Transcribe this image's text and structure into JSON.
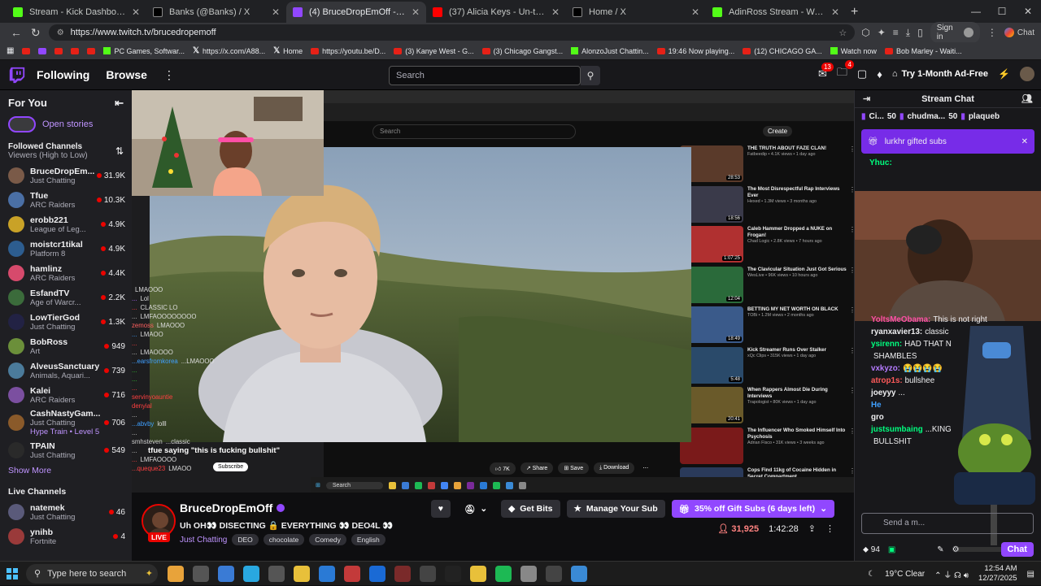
{
  "browser": {
    "tabs": [
      {
        "title": "Stream - Kick Dashboard",
        "color": "#53fc18",
        "active": false
      },
      {
        "title": "Banks (@Banks) / X",
        "color": "#000000",
        "active": false
      },
      {
        "title": "(4) BruceDropEmOff - Twitch",
        "color": "#9147ff",
        "active": true
      },
      {
        "title": "(37) Alicia Keys - Un-thinkable (I'm",
        "color": "#ff0000",
        "active": false
      },
      {
        "title": "Home / X",
        "color": "#000000",
        "active": false
      },
      {
        "title": "AdinRoss Stream - Watch Live on",
        "color": "#53fc18",
        "active": false
      }
    ],
    "url": "https://www.twitch.tv/brucedropemoff",
    "signin_label": "Sign in",
    "chat_label": "Chat",
    "bookmarks": [
      {
        "label": "",
        "type": "yt"
      },
      {
        "label": "",
        "type": "tw"
      },
      {
        "label": "",
        "type": "yt"
      },
      {
        "label": "",
        "type": "yt"
      },
      {
        "label": "",
        "type": "yt"
      },
      {
        "label": "PC Games, Softwar...",
        "type": "k"
      },
      {
        "label": "https://x.com/A88...",
        "type": "x"
      },
      {
        "label": "Home",
        "type": "x"
      },
      {
        "label": "https://youtu.be/D...",
        "type": "yt"
      },
      {
        "label": "(3) Kanye West - G...",
        "type": "yt"
      },
      {
        "label": "(3) Chicago Gangst...",
        "type": "yt"
      },
      {
        "label": "AlonzoJust Chattin...",
        "type": "k"
      },
      {
        "label": "19:46 Now playing...",
        "type": "yt"
      },
      {
        "label": "(12) CHICAGO GA...",
        "type": "yt"
      },
      {
        "label": "Watch now",
        "type": "k"
      },
      {
        "label": "Bob Marley - Waiti...",
        "type": "yt"
      }
    ]
  },
  "twitch": {
    "nav": {
      "following": "Following",
      "browse": "Browse",
      "search_placeholder": "Search",
      "notif_count": "13",
      "inbox_count": "4",
      "adfree": "Try 1-Month Ad-Free"
    },
    "sidebar": {
      "for_you": "For You",
      "open_stories": "Open stories",
      "followed_title": "Followed Channels",
      "followed_sort": "Viewers (High to Low)",
      "channels": [
        {
          "name": "BruceDropEm...",
          "game": "Just Chatting",
          "viewers": "31.9K",
          "color": "#7a5a48"
        },
        {
          "name": "Tfue",
          "game": "ARC Raiders",
          "viewers": "10.3K",
          "color": "#4a6fa5"
        },
        {
          "name": "erobb221",
          "game": "League of Leg...",
          "viewers": "4.9K",
          "color": "#c9a227"
        },
        {
          "name": "moistcr1tikal",
          "game": "Platform 8",
          "viewers": "4.9K",
          "color": "#2d5d8f"
        },
        {
          "name": "hamlinz",
          "game": "ARC Raiders",
          "viewers": "4.4K",
          "color": "#d64a6c"
        },
        {
          "name": "EsfandTV",
          "game": "Age of Warcr...",
          "viewers": "2.2K",
          "color": "#3b6b3b"
        },
        {
          "name": "LowTierGod",
          "game": "Just Chatting",
          "viewers": "1.3K",
          "color": "#222244"
        },
        {
          "name": "BobRoss",
          "game": "Art",
          "viewers": "949",
          "color": "#6b8f3a"
        },
        {
          "name": "AlveusSanctuary",
          "game": "Animals, Aquari...",
          "viewers": "739",
          "color": "#4b7b9b"
        },
        {
          "name": "Kalei",
          "game": "ARC Raiders",
          "viewers": "716",
          "color": "#7b4fa0"
        },
        {
          "name": "CashNastyGam...",
          "game": "Just Chatting",
          "viewers": "706",
          "color": "#8a5a2a",
          "extra": "Hype Train • Level 5"
        },
        {
          "name": "TPAIN",
          "game": "Just Chatting",
          "viewers": "549",
          "color": "#2a2a2a"
        }
      ],
      "show_more": "Show More",
      "live_title": "Live Channels",
      "live": [
        {
          "name": "natemek",
          "game": "Just Chatting",
          "viewers": "46",
          "color": "#5a5a7a"
        },
        {
          "name": "ynihb",
          "game": "Fortnite",
          "viewers": "4",
          "color": "#9a3a3a"
        }
      ]
    },
    "video": {
      "yt_search": "Search",
      "yt_create": "Create",
      "caption": "tfue saying \"this is fucking bullshit\"",
      "actions": [
        "7K",
        "Share",
        "Save",
        "Download"
      ],
      "subscribe": "Subscribe",
      "recs": [
        {
          "title": "THE TRUTH ABOUT FAZE CLAN!",
          "meta": "Fatbeedip • 4.1K views • 1 day ago",
          "dur": "28:53",
          "color": "#5a3a2a"
        },
        {
          "title": "The Most Disrespectful Rap Interviews Ever",
          "meta": "Hexed • 1.3M views • 3 months ago",
          "dur": "18:56",
          "color": "#3a3a4a"
        },
        {
          "title": "Caleb Hammer Dropped a NUKE on Frogan!",
          "meta": "Chad Logic • 2.8K views • 7 hours ago",
          "dur": "1:07:25",
          "color": "#b03030"
        },
        {
          "title": "The Clavicular Situation Just Got Serious",
          "meta": "WesLive • 96K views • 10 hours ago",
          "dur": "12:04",
          "color": "#2a6a3a"
        },
        {
          "title": "BETTING MY NET WORTH ON BLACK",
          "meta": "TOBi • 1.2M views • 2 months ago",
          "dur": "18:49",
          "color": "#3a5a8a"
        },
        {
          "title": "Kick Streamer Runs Over Stalker",
          "meta": "xQc Clips • 315K views • 1 day ago",
          "dur": "5:48",
          "color": "#2a4a6a"
        },
        {
          "title": "When Rappers Almost Die During Interviews",
          "meta": "Trapologist • 80K views • 1 day ago",
          "dur": "20:41",
          "color": "#6a5a2a"
        },
        {
          "title": "The Influencer Who Smoked Himself Into Psychosis",
          "meta": "Adrian Fisco • 31K views • 3 weeks ago",
          "dur": "",
          "color": "#7a1a1a"
        },
        {
          "title": "Cops Find 11kg of Cocaine Hidden in Secret Compartment",
          "meta": "",
          "dur": "",
          "color": "#2a3a5a"
        }
      ],
      "overlay_chat": [
        {
          "user": "",
          "text": "LMAOOO",
          "color": "#ff4040"
        },
        {
          "user": "...",
          "text": "Lol",
          "color": "#aa66ff"
        },
        {
          "user": "...",
          "text": "CLASSIC LO",
          "color": "#ff4040"
        },
        {
          "user": "...",
          "text": "LMFAOOOOOOOO",
          "color": "#cccccc"
        },
        {
          "user": "zemoss",
          "text": "LMAOOO",
          "color": "#ff6060"
        },
        {
          "user": "...",
          "text": "LMAOO",
          "color": "#3fa0ff"
        },
        {
          "user": "...",
          "text": "",
          "color": "#ff4040"
        },
        {
          "user": "...",
          "text": "LMAOOOO",
          "color": "#cccccc"
        },
        {
          "user": "...earsfromkorea",
          "text": "...LMAOOO",
          "color": "#3fa0ff"
        },
        {
          "user": "...",
          "text": "",
          "color": "#30c030"
        },
        {
          "user": "...",
          "text": "",
          "color": "#30c030"
        },
        {
          "user": "...",
          "text": "",
          "color": "#ff4040"
        },
        {
          "user": "servinyoauntie",
          "text": "",
          "color": "#ff4040"
        },
        {
          "user": "denyial",
          "text": "",
          "color": "#ff4040"
        },
        {
          "user": "...",
          "text": "",
          "color": "#cccccc"
        },
        {
          "user": "...abvby",
          "text": "lolll",
          "color": "#3fa0ff"
        },
        {
          "user": "...",
          "text": "",
          "color": "#cccccc"
        },
        {
          "user": "smhsteven",
          "text": "...classic",
          "color": "#cccccc"
        },
        {
          "user": "...",
          "text": "",
          "color": "#cccccc"
        },
        {
          "user": "...",
          "text": "LMFAOOOO",
          "color": "#ff4040"
        },
        {
          "user": "...queque23",
          "text": "LMAOO",
          "color": "#ff4040"
        }
      ],
      "taskbar_search": "Search",
      "taskbar_time": "12:54 AM\n12/27/2025"
    },
    "streamer": {
      "name": "BruceDropEmOff",
      "title": "Uh OH👀 DISECTING 🔒 EVERYTHING 👀 DEO4L 👀",
      "category": "Just Chatting",
      "tags": [
        "DEO",
        "chocolate",
        "Comedy",
        "English"
      ],
      "live": "LIVE",
      "get_bits": "Get Bits",
      "manage_sub": "Manage Your Sub",
      "gift_subs": "35% off Gift Subs (6 days left)",
      "viewers": "31,925",
      "uptime": "1:42:28"
    },
    "chat": {
      "title": "Stream Chat",
      "gift_row": [
        {
          "name": "Ci...",
          "count": ""
        },
        {
          "name": "50",
          "count": ""
        },
        {
          "name": "chudma...",
          "count": ""
        },
        {
          "name": "50",
          "count": ""
        },
        {
          "name": "plaqueb",
          "count": ""
        }
      ],
      "gifted_banner": "lurkhr gifted subs",
      "yhuc": "Yhuc:",
      "messages": [
        {
          "user": "YoltsMeObama:",
          "text": "This is not right",
          "color": "#ff4fa6"
        },
        {
          "user": "ryanxavier13:",
          "text": "classic",
          "color": "#efeff1"
        },
        {
          "user": "ysirenn:",
          "text": "HAD THAT N",
          "color": "#00ff7f"
        },
        {
          "user": "",
          "text": "SHAMBLES",
          "color": "#efeff1"
        },
        {
          "user": "vxkyzo:",
          "text": "😭😭😭😭",
          "color": "#b57bff"
        },
        {
          "user": "atrop1s:",
          "text": "bullshee",
          "color": "#ff5a5a"
        },
        {
          "user": "joeyyy",
          "text": "...",
          "color": "#efeff1"
        },
        {
          "user": "He",
          "text": "",
          "color": "#3fa0ff"
        },
        {
          "user": "gro",
          "text": "",
          "color": "#efeff1"
        },
        {
          "user": "justsumbaing",
          "text": "...KING",
          "color": "#00ff7f"
        },
        {
          "user": "",
          "text": "BULLSHIT",
          "color": "#efeff1"
        }
      ],
      "input_placeholder": "Send a m...",
      "points": "94",
      "chat_button": "Chat"
    }
  },
  "windows": {
    "search": "Type here to search",
    "weather": "19°C  Clear",
    "time": "12:54 AM",
    "date": "12/27/2025",
    "apps": [
      "#e8a33a",
      "#555555",
      "#3a7bd5",
      "#29a8e0",
      "#555555",
      "#e8c03a",
      "#2a7ad5",
      "#c33a3a",
      "#1a6ad5",
      "#7a2a2a",
      "#444444",
      "#222222",
      "#e8c03a",
      "#1db954",
      "#888888",
      "#444444",
      "#3a8ad5"
    ]
  }
}
